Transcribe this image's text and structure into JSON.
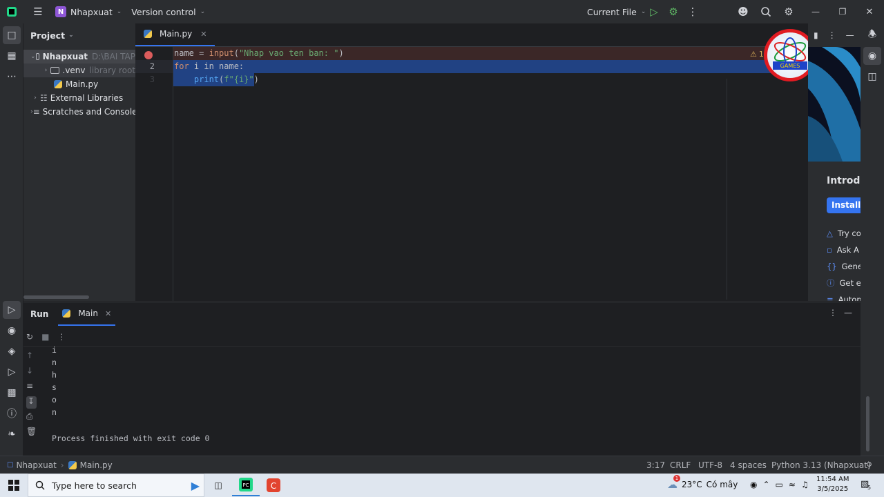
{
  "titlebar": {
    "project_badge": "N",
    "project_name": "Nhapxuat",
    "vcs": "Version control",
    "run_config": "Current File"
  },
  "project_panel": {
    "title": "Project",
    "root_name": "Nhapxuat",
    "root_path": "D:\\BAI TAP",
    "venv_name": ".venv",
    "venv_hint": "library root",
    "main_file": "Main.py",
    "ext_libs": "External Libraries",
    "scratches": "Scratches and Console"
  },
  "editor": {
    "tab_label": "Main.py",
    "line_numbers": [
      "",
      "2",
      "3"
    ],
    "line1": {
      "var": "name",
      "op": " = ",
      "fn": "input",
      "open": "(",
      "str": "\"Nhap vao ten ban: \"",
      "close": ")"
    },
    "line2": {
      "kw": "for",
      "rest": " i in name:"
    },
    "line3": {
      "indent": "    ",
      "fn": "print",
      "open": "(",
      "str": "f\"{i}\"",
      "close": ")"
    },
    "warning_count": "1"
  },
  "ai_panel": {
    "heading": "Introdu",
    "install": "Install F",
    "items": [
      "Try co",
      "Ask A",
      "Gener",
      "Get er",
      "Autom"
    ]
  },
  "run_panel": {
    "title": "Run",
    "tab": "Main",
    "output_lines": [
      "i",
      "n",
      "h",
      "s",
      "o",
      "n"
    ],
    "finished": "Process finished with exit code 0"
  },
  "status": {
    "project": "Nhapxuat",
    "file": "Main.py",
    "position": "3:17",
    "line_sep": "CRLF",
    "encoding": "UTF-8",
    "indent": "4 spaces",
    "interpreter": "Python 3.13 (Nhapxuat)"
  },
  "taskbar": {
    "search_placeholder": "Type here to search",
    "weather": "23°C",
    "weather_desc": "Có mây",
    "time": "11:54 AM",
    "date": "3/5/2025",
    "notif_count": "5",
    "weather_badge": "1"
  },
  "colors": {
    "accent": "#3574f0",
    "breakpoint": "#db5c5c",
    "selection": "#214283"
  }
}
